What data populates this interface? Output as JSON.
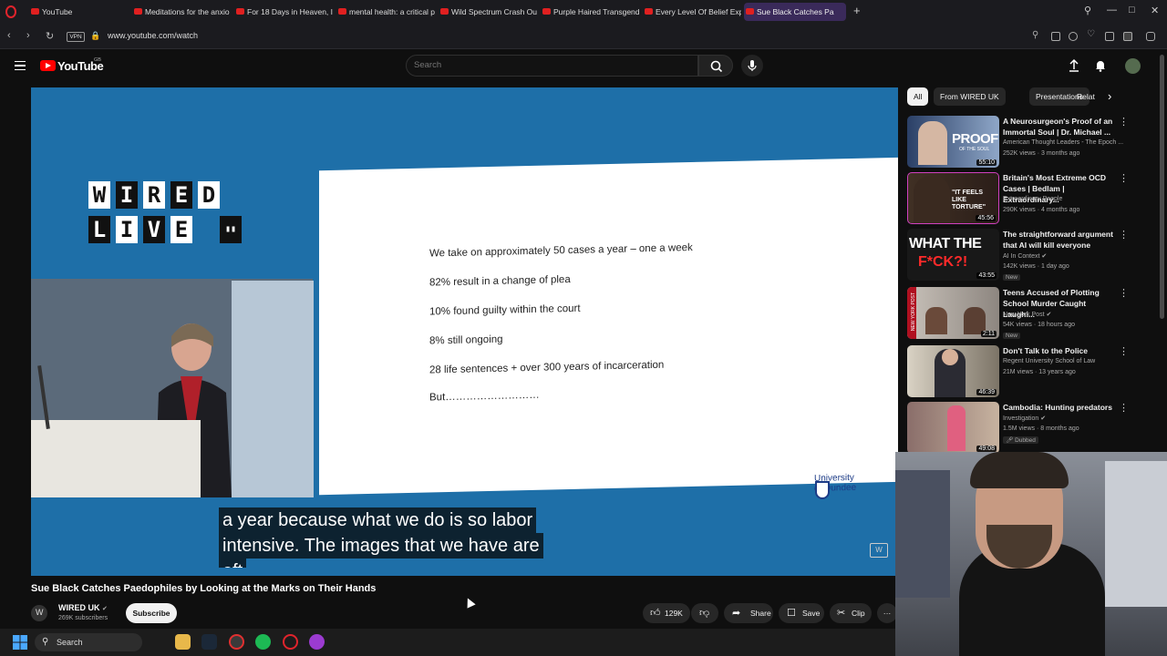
{
  "browser": {
    "tabs": [
      {
        "label": "YouTube"
      },
      {
        "label": "Meditations for the anxio"
      },
      {
        "label": "For 18 Days in Heaven, I W"
      },
      {
        "label": "mental health: a critical p"
      },
      {
        "label": "Wild Spectrum Crash Out"
      },
      {
        "label": "Purple Haired Transgende"
      },
      {
        "label": "Every Level Of Belief Expla"
      },
      {
        "label": "Sue Black Catches Pa"
      }
    ],
    "new_tab": "+",
    "vpn_badge": "VPN",
    "url": "www.youtube.com/watch"
  },
  "youtube": {
    "logo_text": "YouTube",
    "region": "GB",
    "search_placeholder": "Search"
  },
  "video": {
    "slide_lines": [
      "We take on approximately 50 cases a year – one a week",
      "82% result in a change of plea",
      "10% found guilty within the court",
      "8% still ongoing",
      "28 life sentences + over 300 years of incarceration",
      "But………………………"
    ],
    "university_line1": "University",
    "university_line2": "of Dundee",
    "wired_row1": [
      "W",
      "I",
      "R",
      "E",
      "D"
    ],
    "wired_row2": [
      "L",
      "I",
      "V",
      "E"
    ],
    "caption_line1": "a year because what we do is so labor",
    "caption_line2": "intensive. The images that we have are",
    "caption_line3": "oft",
    "title": "Sue Black Catches Paedophiles by Looking at the Marks on Their Hands"
  },
  "channel": {
    "name": "WIRED UK",
    "subscribers": "269K subscribers",
    "subscribe_label": "Subscribe"
  },
  "actions": {
    "likes": "129K",
    "share": "Share",
    "save": "Save",
    "clip": "Clip",
    "more": "···"
  },
  "chips": [
    {
      "label": "All"
    },
    {
      "label": "From WIRED UK"
    },
    {
      "label": "Presentations"
    },
    {
      "label": "Relat"
    }
  ],
  "recommendations": [
    {
      "title": "A Neurosurgeon's Proof of an Immortal Soul | Dr. Michael ...",
      "channel": "American Thought Leaders - The Epoch ...",
      "meta": "252K views · 3 months ago",
      "duration": "55:10",
      "badge": ""
    },
    {
      "title": "Britain's Most Extreme OCD Cases | Bedlam | Extraordinary...",
      "channel": "Extraordinary People",
      "meta": "290K views · 4 months ago",
      "duration": "45:56",
      "badge": ""
    },
    {
      "title": "The straightforward argument that AI will kill everyone",
      "channel": "AI In Context ✔",
      "meta": "142K views · 1 day ago",
      "duration": "43:55",
      "badge": "New"
    },
    {
      "title": "Teens Accused of Plotting School Murder Caught Laughi...",
      "channel": "New York Post ✔",
      "meta": "54K views · 18 hours ago",
      "duration": "2:11",
      "badge": "New"
    },
    {
      "title": "Don't Talk to the Police",
      "channel": "Regent University School of Law",
      "meta": "21M views · 13 years ago",
      "duration": "46:39",
      "badge": ""
    },
    {
      "title": "Cambodia: Hunting predators",
      "channel": "Investigation ✔",
      "meta": "1.5M views · 8 months ago",
      "duration": "49:08",
      "badge": "Dubbed"
    }
  ],
  "thumb_texts": {
    "t1": "PROOF",
    "t1b": "OF THE SOUL",
    "t2": "\"IT FEELS LIKE TORTURE\"",
    "t3a": "WHAT THE",
    "t3b": "F*CK?!",
    "t4": "NEW YORK POST"
  },
  "taskbar": {
    "search": "Search"
  },
  "colors": {
    "accent_red": "#ff0000",
    "video_bg": "#1e6fa8",
    "dundee_blue": "#1d3c87"
  }
}
